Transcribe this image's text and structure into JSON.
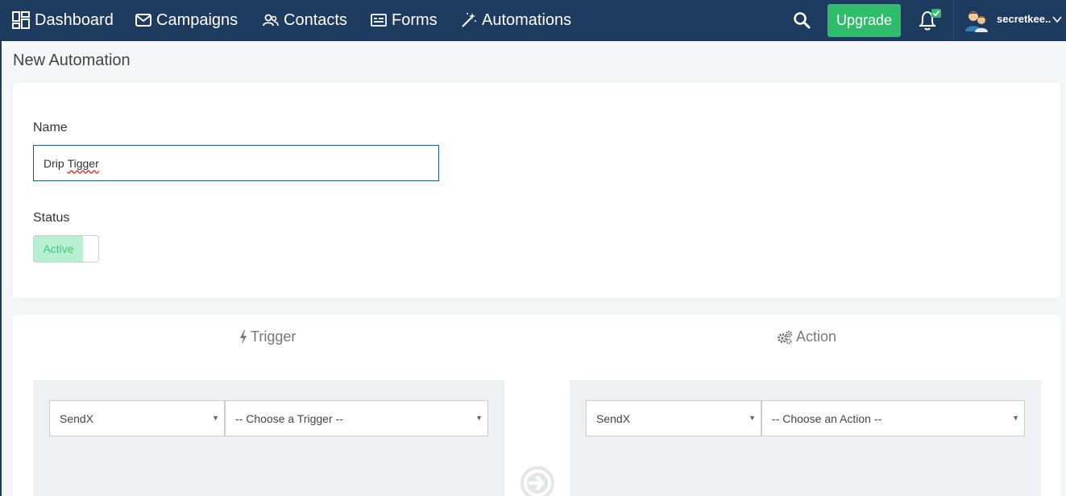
{
  "nav": {
    "items": [
      {
        "label": "Dashboard",
        "icon": "dashboard-icon"
      },
      {
        "label": "Campaigns",
        "icon": "envelope-icon"
      },
      {
        "label": "Contacts",
        "icon": "users-icon"
      },
      {
        "label": "Forms",
        "icon": "form-icon"
      },
      {
        "label": "Automations",
        "icon": "magic-wand-icon"
      }
    ],
    "upgrade_label": "Upgrade",
    "user_name": "secretkee..."
  },
  "page": {
    "title": "New Automation"
  },
  "form": {
    "name_label": "Name",
    "name_value_part1": "Drip ",
    "name_value_part2": "Tigger",
    "status_label": "Status",
    "status_value": "Active"
  },
  "flow": {
    "trigger_heading": "Trigger",
    "action_heading": "Action",
    "trigger_app": "SendX",
    "trigger_placeholder": "-- Choose a Trigger --",
    "action_app": "SendX",
    "action_placeholder": "-- Choose an Action --"
  },
  "colors": {
    "navbar": "#1d3b5e",
    "upgrade": "#2ebd6b",
    "status_active_bg": "#b7f0d0",
    "status_active_text": "#3cc77e",
    "input_border": "#1f5a96"
  }
}
